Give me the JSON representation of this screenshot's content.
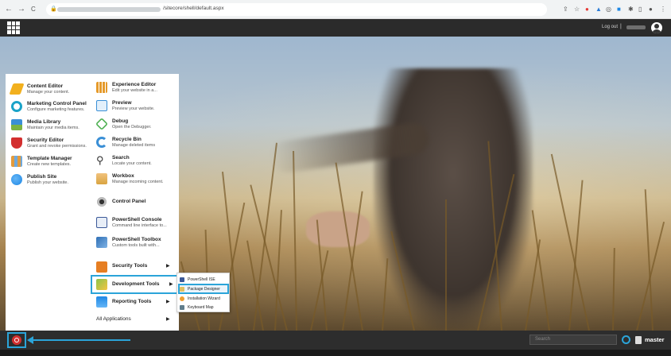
{
  "browser": {
    "nav_back": "←",
    "nav_forward": "→",
    "nav_reload": "C",
    "url_path": "/sitecore/shell/default.aspx"
  },
  "header": {
    "logout_label": "Log out",
    "separator": "|"
  },
  "menu": {
    "left": [
      {
        "title": "Content Editor",
        "desc": "Manage your content.",
        "icon": "pencil-icon",
        "color": "#f2b01e"
      },
      {
        "title": "Marketing Control Panel",
        "desc": "Configure marketing features.",
        "icon": "marketing-icon",
        "color": "#1aa3c8"
      },
      {
        "title": "Media Library",
        "desc": "Maintain your media items.",
        "icon": "media-icon",
        "color": "#3a8fd6"
      },
      {
        "title": "Security Editor",
        "desc": "Grant and revoke permissions.",
        "icon": "shield-icon",
        "color": "#d32f2f"
      },
      {
        "title": "Template Manager",
        "desc": "Create new templates.",
        "icon": "template-icon",
        "color": "#e39b3c"
      },
      {
        "title": "Publish Site",
        "desc": "Publish your website.",
        "icon": "globe-icon",
        "color": "#1e88e5"
      }
    ],
    "right": [
      {
        "title": "Experience Editor",
        "desc": "Edit your website in a...",
        "icon": "experience-icon",
        "color": "#e59a2a"
      },
      {
        "title": "Preview",
        "desc": "Preview your website.",
        "icon": "preview-icon",
        "color": "#3a8fd6"
      },
      {
        "title": "Debug",
        "desc": "Open the Debugger.",
        "icon": "debug-icon",
        "color": "#4caf50"
      },
      {
        "title": "Recycle Bin",
        "desc": "Manage deleted items",
        "icon": "recycle-icon",
        "color": "#3a8fd6"
      },
      {
        "title": "Search",
        "desc": "Locate your content.",
        "icon": "search-icon",
        "color": "#444444"
      },
      {
        "title": "Workbox",
        "desc": "Manage incoming content.",
        "icon": "workbox-icon",
        "color": "#d9a441"
      },
      {
        "title": "Control Panel",
        "desc": "",
        "icon": "control-panel-icon",
        "color": "#555555"
      },
      {
        "title": "PowerShell Console",
        "desc": "Command line interface to...",
        "icon": "powershell-console-icon",
        "color": "#3b5998"
      },
      {
        "title": "PowerShell Toolbox",
        "desc": "Custom tools built with...",
        "icon": "powershell-toolbox-icon",
        "color": "#2f6fb5"
      }
    ],
    "submenus": [
      {
        "title": "Security Tools",
        "icon": "lock-icon",
        "color": "#e67e22"
      },
      {
        "title": "Development Tools",
        "icon": "development-tools-icon",
        "color": "#8bc34a"
      },
      {
        "title": "Reporting Tools",
        "icon": "reporting-icon",
        "color": "#1e88e5"
      },
      {
        "title": "All Applications",
        "icon": "",
        "color": ""
      }
    ]
  },
  "dev_submenu": [
    {
      "label": "PowerShell ISE",
      "icon": "powershell-ise-icon",
      "color": "#3b5998"
    },
    {
      "label": "Package Designer",
      "icon": "package-icon",
      "color": "#e0c060"
    },
    {
      "label": "Installation Wizard",
      "icon": "wizard-icon",
      "color": "#f0a030"
    },
    {
      "label": "Keyboard Map",
      "icon": "keyboard-icon",
      "color": "#607d8b"
    }
  ],
  "taskbar": {
    "search_placeholder": "Search",
    "database": "master"
  },
  "accent_color": "#2ba4d9"
}
